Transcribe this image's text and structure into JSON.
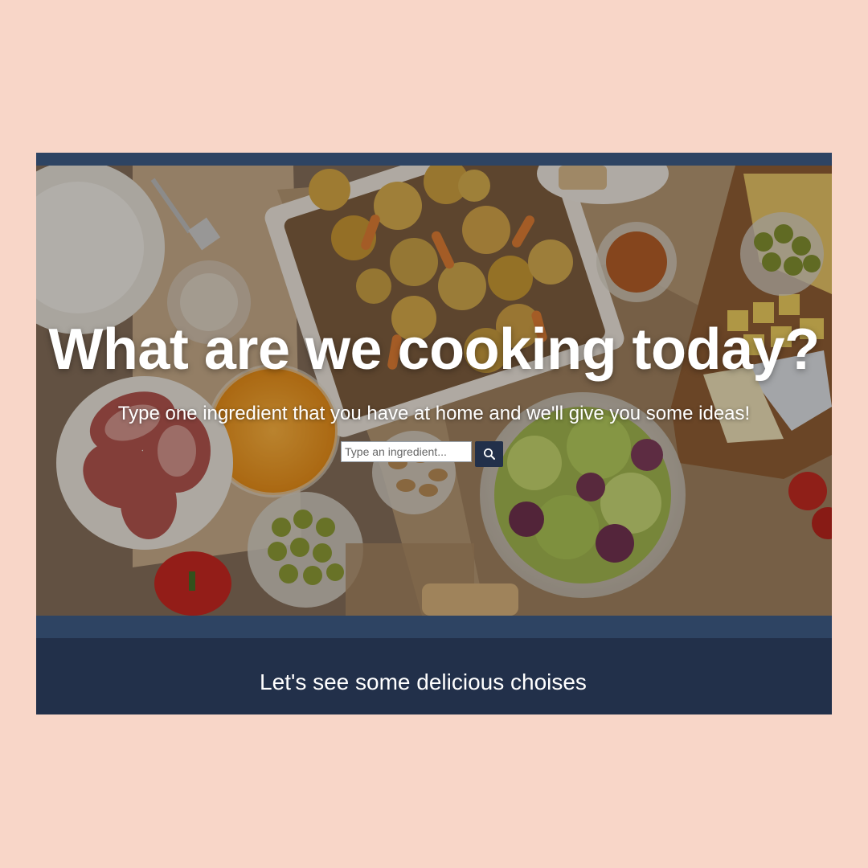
{
  "hero": {
    "headline": "What are we cooking today?",
    "subline": "Type one ingredient that you have at home and we'll give you some ideas!",
    "search": {
      "placeholder": "Type an ingredient...",
      "value": "",
      "button_icon": "search-icon"
    },
    "background": "food-table-photo"
  },
  "results": {
    "heading": "Let's see some delicious choises"
  },
  "colors": {
    "page_background": "#f8d6c8",
    "navy": "#22304a",
    "strip": "#2e4463",
    "text": "#ffffff"
  }
}
